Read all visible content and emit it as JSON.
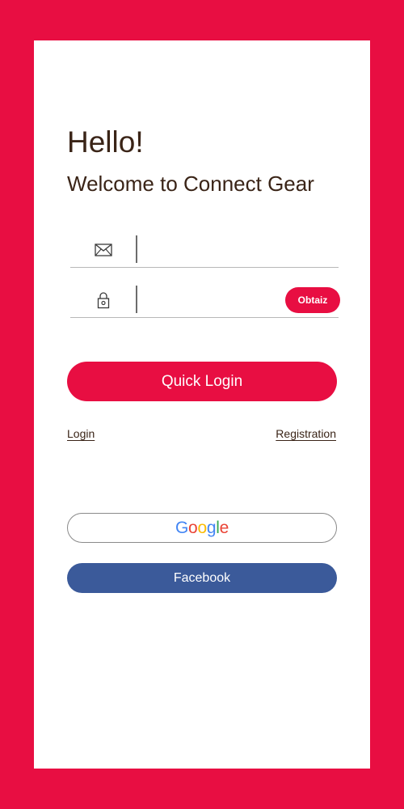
{
  "header": {
    "title": "Hello!",
    "subtitle": "Welcome to Connect Gear"
  },
  "form": {
    "email": {
      "icon": "envelope-icon",
      "value": "",
      "placeholder": ""
    },
    "password": {
      "icon": "lock-icon",
      "value": "",
      "placeholder": ""
    },
    "obtain_label": "Obtaiz",
    "quick_login_label": "Quick Login"
  },
  "links": {
    "login": "Login",
    "registration": "Registration"
  },
  "social": {
    "google": {
      "letters": [
        "G",
        "o",
        "o",
        "g",
        "l",
        "e"
      ],
      "colors": [
        "#4285F4",
        "#EA4335",
        "#FBBC05",
        "#4285F4",
        "#34A853",
        "#EA4335"
      ]
    },
    "facebook_label": "Facebook"
  },
  "theme": {
    "accent": "#E80E42",
    "text": "#3A2417",
    "facebook": "#3B5A9A"
  }
}
